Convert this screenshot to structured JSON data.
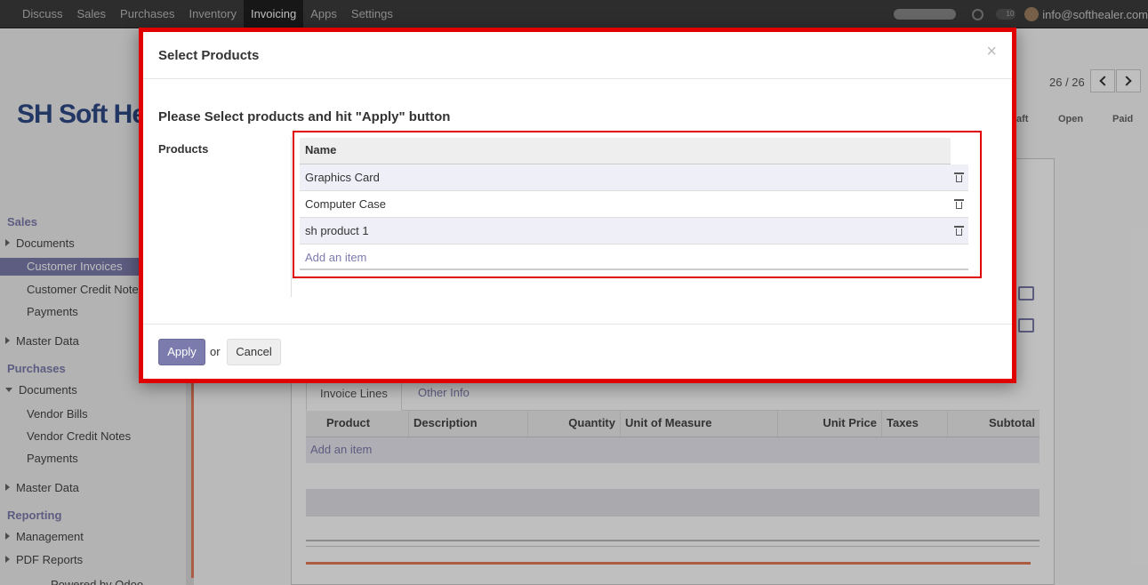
{
  "topbar": {
    "menu": [
      "Discuss",
      "Sales",
      "Purchases",
      "Inventory",
      "Invoicing",
      "Apps",
      "Settings"
    ],
    "chat_count": "10",
    "user_email": "info@softhealer.com"
  },
  "sidebar": {
    "logo_text": "SH Soft Hea",
    "sections": {
      "sales": "Sales",
      "sales_documents": "Documents",
      "customer_invoices": "Customer Invoices",
      "customer_credit_notes": "Customer Credit Notes",
      "sales_payments": "Payments",
      "sales_master_data": "Master Data",
      "purchases": "Purchases",
      "purchases_documents": "Documents",
      "vendor_bills": "Vendor Bills",
      "vendor_credit_notes": "Vendor Credit Notes",
      "purchases_payments": "Payments",
      "purchases_master_data": "Master Data",
      "reporting": "Reporting",
      "management": "Management",
      "pdf_reports": "PDF Reports",
      "powered_by": "Powered by Odoo"
    }
  },
  "control_panel": {
    "pager": "26 / 26",
    "status": [
      "aft",
      "Open",
      "Paid"
    ]
  },
  "form": {
    "tabs": [
      "Invoice Lines",
      "Other Info"
    ],
    "columns": [
      "Product",
      "Description",
      "Quantity",
      "Unit of Measure",
      "Unit Price",
      "Taxes",
      "Subtotal"
    ],
    "add_item": "Add an item"
  },
  "modal": {
    "title": "Select Products",
    "close": "×",
    "instruction": "Please Select products and hit \"Apply\" button",
    "field_label": "Products",
    "list": {
      "header": "Name",
      "rows": [
        "Graphics Card",
        "Computer Case",
        "sh product 1"
      ],
      "add_item": "Add an item"
    },
    "footer": {
      "apply": "Apply",
      "or": "or",
      "cancel": "Cancel"
    }
  },
  "colors": {
    "accent": "#7c7bad",
    "highlight_border": "#e00000",
    "topbar": "#3d3d3d"
  }
}
